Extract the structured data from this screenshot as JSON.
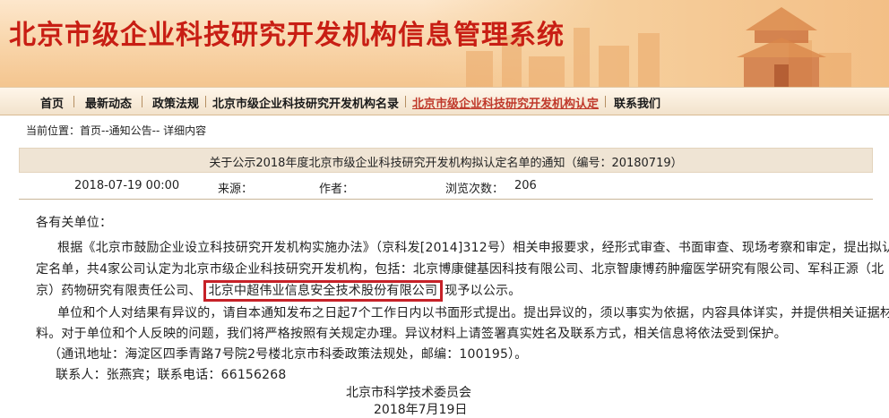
{
  "banner": {
    "title": "北京市级企业科技研究开发机构信息管理系统"
  },
  "nav": {
    "items": [
      {
        "label": "首页"
      },
      {
        "label": "最新动态"
      },
      {
        "label": "政策法规"
      },
      {
        "label": "北京市级企业科技研究开发机构名录"
      },
      {
        "label": "北京市级企业科技研究开发机构认定"
      },
      {
        "label": "联系我们"
      }
    ]
  },
  "breadcrumb": {
    "label": "当前位置：",
    "path": "首页--通知公告-- 详细内容"
  },
  "notice": {
    "title": "关于公示2018年度北京市级企业科技研究开发机构拟认定名单的通知（编号：20180719）",
    "meta": {
      "date": "2018-07-19 00:00",
      "source_label": "来源：",
      "author_label": "作者：",
      "views_label": "浏览次数：",
      "views": "206"
    },
    "salutation": "各有关单位：",
    "lines": [
      "根据《北京市鼓励企业设立科技研究开发机构实施办法》（京科发[2014]312号）相关申报要求，经形式审查、书面审查、现场考察和审定，提出拟认",
      "定名单，共4家公司认定为北京市级企业科技研究开发机构，包括：北京博康健基因科技有限公司、北京智康博药肿瘤医学研究有限公司、军科正源（北",
      "京）药物研究有限责任公司、",
      "现予以公示。",
      "单位和个人对结果有异议的，请自本通知发布之日起7个工作日内以书面形式提出。提出异议的，须以事实为依据，内容具体详实，并提供相关证据材",
      "料。对于单位和个人反映的问题，我们将严格按照有关规定办理。异议材料上请签署真实姓名及联系方式，相关信息将依法受到保护。",
      "（通讯地址：海淀区四季青路7号院2号楼北京市科委政策法规处，邮编：100195）。",
      "联系人：张燕宾；联系电话：66156268"
    ],
    "highlighted_company": "北京中超伟业信息安全技术股份有限公司",
    "signature": {
      "org": "北京市科学技术委员会",
      "date": "2018年7月19日"
    }
  },
  "colors": {
    "title_red": "#c81e14",
    "highlight_border": "#c62128",
    "nav_active": "#c0392b"
  }
}
